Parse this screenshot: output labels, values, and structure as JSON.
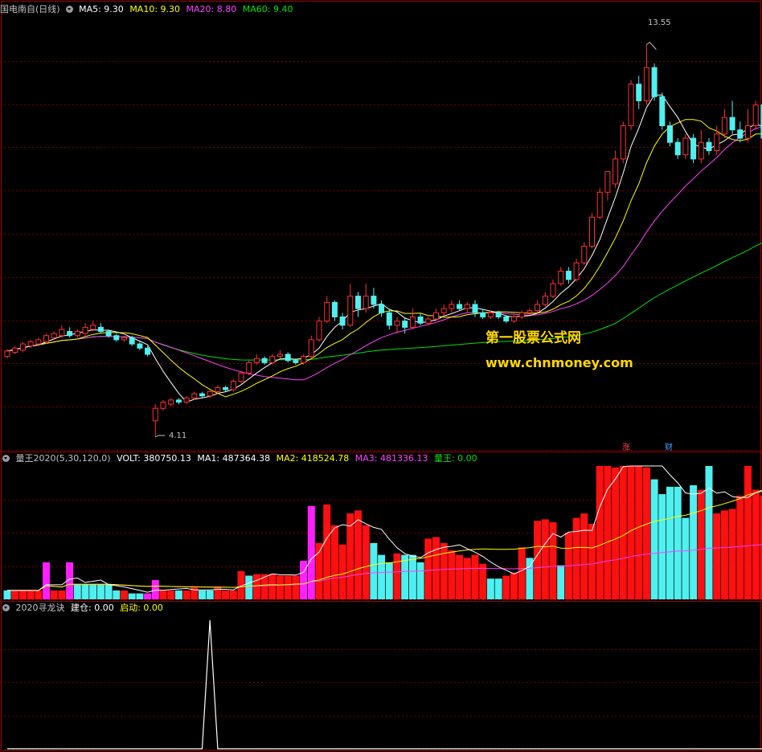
{
  "panel1": {
    "stock_name": "国电南自",
    "period": "(日线)",
    "legend": [
      {
        "label": "MA5: 9.30",
        "color": "#ffffff"
      },
      {
        "label": "MA10: 9.30",
        "color": "#ffff00"
      },
      {
        "label": "MA20: 8.80",
        "color": "#ff40ff"
      },
      {
        "label": "MA60: 9.40",
        "color": "#00e000"
      }
    ],
    "high_label": "13.55",
    "low_label": "4.11",
    "badge_zhang": "涨",
    "badge_cai": "财"
  },
  "panel2": {
    "legend": [
      {
        "label": "量王2020(5,30,120,0)",
        "color": "#c0c0c0"
      },
      {
        "label": "VOLT: 380750.13",
        "color": "#ffffff"
      },
      {
        "label": "MA1: 487364.38",
        "color": "#ffffff"
      },
      {
        "label": "MA2: 418524.78",
        "color": "#ffff00"
      },
      {
        "label": "MA3: 481336.13",
        "color": "#ff40ff"
      },
      {
        "label": "量王: 0.00",
        "color": "#00e000"
      }
    ]
  },
  "panel3": {
    "legend": [
      {
        "label": "2020寻龙诀",
        "color": "#c0c0c0"
      },
      {
        "label": "建仓: 0.00",
        "color": "#ffffff"
      },
      {
        "label": "启动: 0.00",
        "color": "#ffff00"
      }
    ]
  },
  "watermark": {
    "line1": "第一股票公式网",
    "line2": "www.chnmoney.com"
  },
  "chart_data": {
    "type": "candlestick",
    "price_range": [
      3.8,
      14.2
    ],
    "grid": true,
    "candles": [
      [
        6.05,
        6.18,
        6.22,
        6.0
      ],
      [
        6.15,
        6.25,
        6.3,
        6.1
      ],
      [
        6.2,
        6.35,
        6.4,
        6.15
      ],
      [
        6.3,
        6.4,
        6.45,
        6.25
      ],
      [
        6.35,
        6.45,
        6.5,
        6.3
      ],
      [
        6.4,
        6.55,
        6.6,
        6.35
      ],
      [
        6.5,
        6.6,
        6.65,
        6.45
      ],
      [
        6.55,
        6.7,
        6.8,
        6.5
      ],
      [
        6.65,
        6.55,
        6.75,
        6.5
      ],
      [
        6.55,
        6.65,
        6.7,
        6.5
      ],
      [
        6.6,
        6.75,
        6.85,
        6.55
      ],
      [
        6.7,
        6.8,
        6.9,
        6.65
      ],
      [
        6.75,
        6.65,
        6.85,
        6.6
      ],
      [
        6.65,
        6.55,
        6.7,
        6.5
      ],
      [
        6.55,
        6.45,
        6.6,
        6.4
      ],
      [
        6.45,
        6.5,
        6.55,
        6.4
      ],
      [
        6.5,
        6.35,
        6.55,
        6.3
      ],
      [
        6.35,
        6.25,
        6.4,
        6.2
      ],
      [
        6.25,
        6.1,
        6.3,
        6.05
      ],
      [
        4.5,
        4.8,
        4.9,
        4.11
      ],
      [
        4.8,
        4.95,
        5.0,
        4.75
      ],
      [
        4.9,
        5.0,
        5.05,
        4.85
      ],
      [
        5.0,
        4.95,
        5.05,
        4.9
      ],
      [
        4.95,
        5.05,
        5.1,
        4.9
      ],
      [
        5.05,
        5.15,
        5.2,
        5.0
      ],
      [
        5.15,
        5.1,
        5.2,
        5.05
      ],
      [
        5.1,
        5.2,
        5.25,
        5.05
      ],
      [
        5.2,
        5.3,
        5.35,
        5.15
      ],
      [
        5.3,
        5.25,
        5.35,
        5.2
      ],
      [
        5.25,
        5.45,
        5.5,
        5.2
      ],
      [
        5.45,
        5.65,
        5.7,
        5.4
      ],
      [
        5.65,
        5.9,
        5.95,
        5.6
      ],
      [
        5.9,
        6.0,
        6.1,
        5.85
      ],
      [
        6.0,
        5.9,
        6.05,
        5.85
      ],
      [
        5.9,
        6.05,
        6.1,
        5.85
      ],
      [
        6.05,
        6.1,
        6.2,
        6.0
      ],
      [
        6.1,
        5.95,
        6.15,
        5.9
      ],
      [
        5.95,
        5.9,
        6.0,
        5.85
      ],
      [
        5.9,
        6.05,
        6.1,
        5.85
      ],
      [
        6.05,
        6.45,
        6.55,
        6.0
      ],
      [
        6.45,
        6.9,
        7.0,
        6.4
      ],
      [
        6.9,
        7.35,
        7.5,
        6.85
      ],
      [
        7.35,
        7.0,
        7.4,
        6.9
      ],
      [
        7.0,
        6.8,
        7.1,
        6.7
      ],
      [
        6.8,
        7.5,
        7.8,
        6.75
      ],
      [
        7.5,
        7.2,
        7.6,
        7.0
      ],
      [
        7.2,
        7.5,
        7.8,
        7.1
      ],
      [
        7.5,
        7.3,
        7.7,
        7.2
      ],
      [
        7.3,
        7.1,
        7.4,
        7.0
      ],
      [
        7.1,
        6.8,
        7.2,
        6.7
      ],
      [
        6.8,
        6.9,
        7.0,
        6.6
      ],
      [
        6.9,
        6.75,
        7.0,
        6.6
      ],
      [
        6.75,
        7.0,
        7.2,
        6.7
      ],
      [
        7.0,
        6.85,
        7.1,
        6.8
      ],
      [
        6.85,
        6.95,
        7.0,
        6.8
      ],
      [
        6.95,
        7.1,
        7.2,
        6.9
      ],
      [
        7.1,
        7.2,
        7.3,
        7.0
      ],
      [
        7.2,
        7.3,
        7.4,
        7.1
      ],
      [
        7.3,
        7.2,
        7.4,
        7.15
      ],
      [
        7.2,
        7.3,
        7.35,
        7.1
      ],
      [
        7.3,
        7.1,
        7.4,
        7.0
      ],
      [
        7.1,
        7.0,
        7.2,
        6.95
      ],
      [
        7.0,
        7.1,
        7.15,
        6.95
      ],
      [
        7.1,
        7.0,
        7.15,
        6.95
      ],
      [
        7.0,
        6.9,
        7.05,
        6.85
      ],
      [
        6.9,
        7.0,
        7.05,
        6.85
      ],
      [
        7.0,
        7.1,
        7.15,
        6.95
      ],
      [
        7.1,
        7.15,
        7.2,
        7.05
      ],
      [
        7.15,
        7.3,
        7.4,
        7.1
      ],
      [
        7.3,
        7.5,
        7.6,
        7.25
      ],
      [
        7.5,
        7.8,
        7.9,
        7.45
      ],
      [
        7.8,
        8.1,
        8.2,
        7.75
      ],
      [
        8.1,
        7.9,
        8.2,
        7.8
      ],
      [
        7.9,
        8.3,
        8.4,
        7.85
      ],
      [
        8.3,
        8.7,
        8.8,
        8.25
      ],
      [
        8.7,
        9.4,
        9.5,
        8.65
      ],
      [
        9.4,
        10.0,
        10.1,
        9.35
      ],
      [
        10.0,
        10.5,
        10.5,
        9.8
      ],
      [
        10.2,
        10.8,
        11.0,
        10.1
      ],
      [
        10.8,
        11.6,
        11.7,
        10.7
      ],
      [
        11.6,
        12.6,
        12.7,
        11.5
      ],
      [
        12.6,
        12.2,
        12.8,
        12.0
      ],
      [
        12.2,
        13.0,
        13.55,
        12.1
      ],
      [
        13.0,
        12.3,
        13.1,
        12.2
      ],
      [
        12.3,
        11.6,
        12.4,
        11.5
      ],
      [
        11.6,
        11.2,
        11.7,
        11.1
      ],
      [
        11.2,
        10.9,
        11.3,
        10.8
      ],
      [
        10.9,
        11.3,
        11.4,
        10.8
      ],
      [
        11.3,
        10.8,
        11.4,
        10.7
      ],
      [
        10.8,
        11.2,
        11.5,
        10.7
      ],
      [
        11.2,
        11.0,
        11.3,
        10.9
      ],
      [
        11.0,
        11.4,
        11.6,
        10.9
      ],
      [
        11.4,
        11.8,
        12.0,
        11.3
      ],
      [
        11.8,
        11.5,
        12.2,
        11.4
      ],
      [
        11.5,
        11.3,
        11.7,
        11.2
      ],
      [
        11.3,
        11.6,
        12.0,
        11.2
      ],
      [
        11.6,
        12.1,
        12.2,
        11.5
      ],
      [
        12.1,
        11.3,
        12.2,
        11.2
      ],
      [
        11.3,
        11.6,
        11.8,
        11.2
      ]
    ],
    "volume_range": [
      0,
      900000
    ],
    "volume": [
      [
        60000,
        "c"
      ],
      [
        60000,
        "r"
      ],
      [
        60000,
        "r"
      ],
      [
        60000,
        "r"
      ],
      [
        60000,
        "r"
      ],
      [
        250000,
        "m"
      ],
      [
        60000,
        "r"
      ],
      [
        60000,
        "r"
      ],
      [
        250000,
        "m"
      ],
      [
        100000,
        "c"
      ],
      [
        100000,
        "c"
      ],
      [
        100000,
        "c"
      ],
      [
        100000,
        "c"
      ],
      [
        100000,
        "c"
      ],
      [
        60000,
        "c"
      ],
      [
        60000,
        "r"
      ],
      [
        40000,
        "c"
      ],
      [
        40000,
        "c"
      ],
      [
        40000,
        "m"
      ],
      [
        130000,
        "m"
      ],
      [
        60000,
        "r"
      ],
      [
        60000,
        "r"
      ],
      [
        60000,
        "c"
      ],
      [
        60000,
        "r"
      ],
      [
        80000,
        "r"
      ],
      [
        60000,
        "c"
      ],
      [
        60000,
        "c"
      ],
      [
        80000,
        "r"
      ],
      [
        60000,
        "r"
      ],
      [
        60000,
        "r"
      ],
      [
        190000,
        "r"
      ],
      [
        160000,
        "c"
      ],
      [
        170000,
        "r"
      ],
      [
        170000,
        "r"
      ],
      [
        170000,
        "r"
      ],
      [
        160000,
        "r"
      ],
      [
        160000,
        "r"
      ],
      [
        160000,
        "r"
      ],
      [
        260000,
        "m"
      ],
      [
        630000,
        "m"
      ],
      [
        380000,
        "r"
      ],
      [
        640000,
        "r"
      ],
      [
        500000,
        "r"
      ],
      [
        370000,
        "r"
      ],
      [
        580000,
        "r"
      ],
      [
        600000,
        "r"
      ],
      [
        500000,
        "r"
      ],
      [
        380000,
        "c"
      ],
      [
        300000,
        "c"
      ],
      [
        250000,
        "c"
      ],
      [
        310000,
        "r"
      ],
      [
        300000,
        "c"
      ],
      [
        300000,
        "c"
      ],
      [
        250000,
        "c"
      ],
      [
        410000,
        "r"
      ],
      [
        420000,
        "r"
      ],
      [
        380000,
        "r"
      ],
      [
        330000,
        "r"
      ],
      [
        300000,
        "r"
      ],
      [
        280000,
        "r"
      ],
      [
        300000,
        "r"
      ],
      [
        240000,
        "r"
      ],
      [
        140000,
        "c"
      ],
      [
        140000,
        "c"
      ],
      [
        160000,
        "r"
      ],
      [
        180000,
        "r"
      ],
      [
        350000,
        "r"
      ],
      [
        280000,
        "c"
      ],
      [
        530000,
        "r"
      ],
      [
        540000,
        "r"
      ],
      [
        520000,
        "r"
      ],
      [
        230000,
        "c"
      ],
      [
        450000,
        "r"
      ],
      [
        550000,
        "r"
      ],
      [
        580000,
        "r"
      ],
      [
        510000,
        "r"
      ],
      [
        1030000,
        "r"
      ],
      [
        1050000,
        "r"
      ],
      [
        890000,
        "r"
      ],
      [
        1000000,
        "r"
      ],
      [
        1260000,
        "r"
      ],
      [
        1030000,
        "r"
      ],
      [
        890000,
        "r"
      ],
      [
        810000,
        "c"
      ],
      [
        710000,
        "c"
      ],
      [
        760000,
        "c"
      ],
      [
        760000,
        "c"
      ],
      [
        550000,
        "c"
      ],
      [
        770000,
        "c"
      ],
      [
        740000,
        "r"
      ],
      [
        940000,
        "c"
      ],
      [
        580000,
        "r"
      ],
      [
        600000,
        "r"
      ],
      [
        610000,
        "r"
      ],
      [
        700000,
        "r"
      ],
      [
        950000,
        "r"
      ],
      [
        740000,
        "r"
      ],
      [
        700000,
        "r"
      ],
      [
        710000,
        "c"
      ]
    ],
    "signal_range": [
      0,
      1
    ],
    "signal_peak_index": 26
  }
}
